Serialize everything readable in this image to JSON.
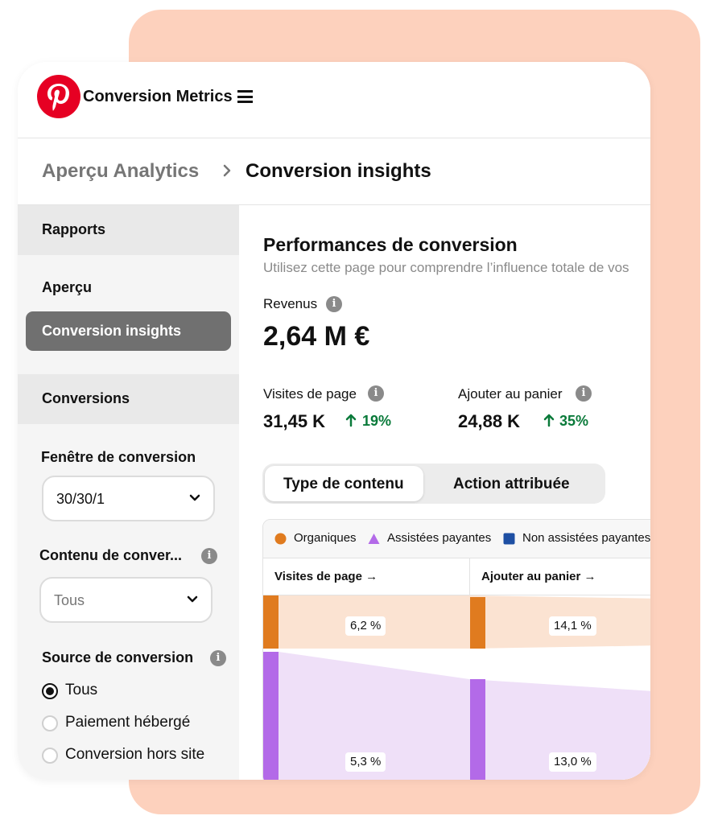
{
  "header": {
    "app_title": "Conversion Metrics"
  },
  "breadcrumb": {
    "parent": "Aperçu Analytics",
    "current": "Conversion insights"
  },
  "sidebar": {
    "section_reports": "Rapports",
    "link_overview": "Aperçu",
    "link_active": "Conversion insights",
    "section_conversions": "Conversions",
    "window_label": "Fenêtre de conversion",
    "window_value": "30/30/1",
    "content_label": "Contenu de conver...",
    "content_value": "Tous",
    "source_label": "Source de conversion",
    "source_options": [
      "Tous",
      "Paiement hébergé",
      "Conversion hors site"
    ],
    "source_selected": "Tous"
  },
  "main": {
    "title": "Performances de conversion",
    "subtitle": "Utilisez cette page pour comprendre l’influence totale de vos",
    "revenue_label": "Revenus",
    "revenue_value": "2,64 M €",
    "kpis": [
      {
        "label": "Visites de page",
        "value": "31,45 K",
        "delta": "19%"
      },
      {
        "label": "Ajouter au panier",
        "value": "24,88 K",
        "delta": "35%"
      }
    ],
    "tabs": {
      "active": "Type de contenu",
      "inactive": "Action attribuée"
    },
    "delta_color": "#0a7a3a"
  },
  "chart_data": {
    "type": "funnel",
    "legend": [
      "Organiques",
      "Assistées payantes",
      "Non assistées payantes"
    ],
    "colors": {
      "Organiques": "#e07b1f",
      "Assistées payantes": "#b36ae8",
      "Non assistées payantes": "#1e4fa3"
    },
    "stages": [
      "Visites de page",
      "Ajouter au panier"
    ],
    "series": [
      {
        "name": "Organiques",
        "values": [
          "6,2 %",
          "14,1 %"
        ]
      },
      {
        "name": "Assistées payantes",
        "values": [
          "5,3 %",
          "13,0 %"
        ]
      }
    ]
  }
}
